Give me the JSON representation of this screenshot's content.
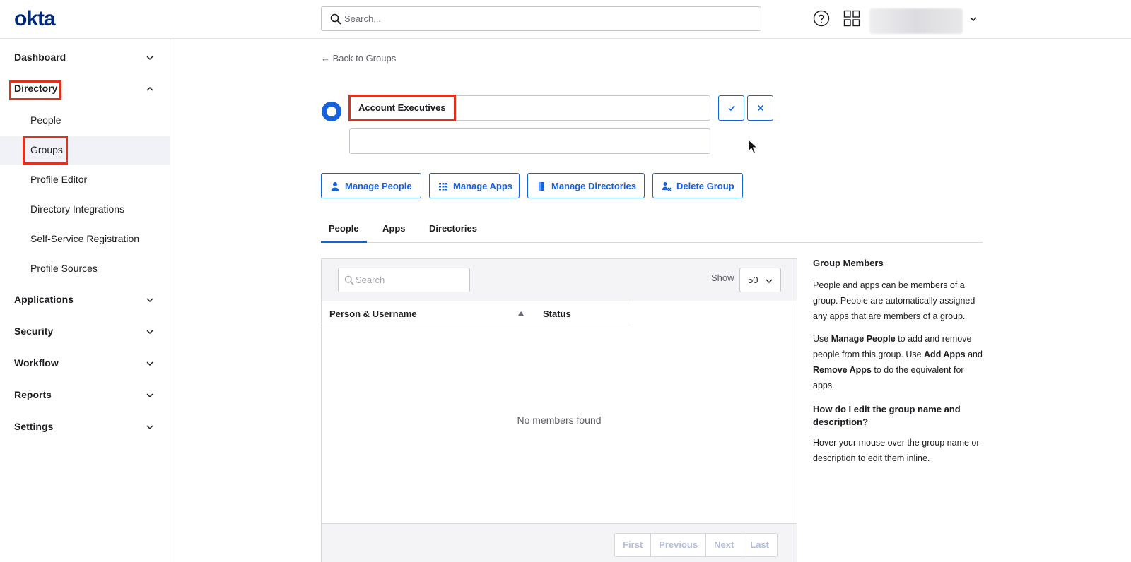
{
  "header": {
    "logo": "okta",
    "search_placeholder": "Search..."
  },
  "sidebar": {
    "dashboard": "Dashboard",
    "directory": "Directory",
    "directory_items": [
      "People",
      "Groups",
      "Profile Editor",
      "Directory Integrations",
      "Self-Service Registration",
      "Profile Sources"
    ],
    "active_item": "Groups",
    "applications": "Applications",
    "security": "Security",
    "workflow": "Workflow",
    "reports": "Reports",
    "settings": "Settings"
  },
  "main": {
    "back_link": "← Back to Groups",
    "group_name": "Account Executives",
    "group_description": "",
    "buttons": {
      "manage_people": "Manage People",
      "manage_apps": "Manage Apps",
      "manage_directories": "Manage Directories",
      "delete_group": "Delete Group"
    },
    "tabs": [
      "People",
      "Apps",
      "Directories"
    ],
    "active_tab": "People",
    "table": {
      "search_placeholder": "Search",
      "show_label": "Show",
      "page_size": "50",
      "columns": [
        "Person & Username",
        "Status"
      ],
      "empty_message": "No members found",
      "pager": [
        "First",
        "Previous",
        "Next",
        "Last"
      ]
    }
  },
  "help": {
    "title": "Group Members",
    "para1": "People and apps can be members of a group. People are automatically assigned any apps that are members of a group.",
    "para2_parts": [
      "Use ",
      "Manage People",
      " to add and remove people from this group. Use ",
      "Add Apps",
      " and ",
      "Remove Apps",
      " to do the equivalent for apps."
    ],
    "title2": "How do I edit the group name and description?",
    "para3": "Hover your mouse over the group name or description to edit them inline."
  },
  "colors": {
    "accent": "#1662dd",
    "brand": "#00297a",
    "highlight": "#e0301e"
  }
}
